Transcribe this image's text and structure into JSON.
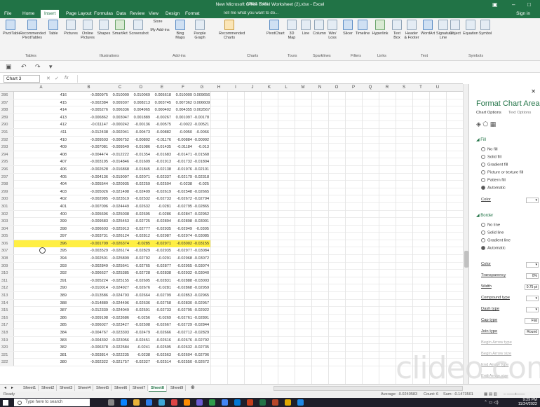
{
  "titlebar": {
    "tools": "Chart Tools",
    "document": "New Microsoft Office Excel Worksheet (2).xlsx - Excel"
  },
  "menubar": {
    "tabs": [
      "File",
      "Home",
      "Insert",
      "Page Layout",
      "Formulas",
      "Data",
      "Review",
      "View",
      "Design",
      "Format"
    ],
    "active": "Insert",
    "tellme": "Tell me what you want to do...",
    "signin": "Sign in"
  },
  "ribbon": {
    "buttons": [
      "PivotTable",
      "Recommended PivotTables",
      "Table",
      "Pictures",
      "Online Pictures",
      "Shapes",
      "SmartArt",
      "Screenshot",
      "Store",
      "My Add-ins",
      "Bing Maps",
      "People Graph",
      "Recommended Charts",
      "PivotChart",
      "3D Map",
      "Line",
      "Column",
      "Win/ Loss",
      "Slicer",
      "Timeline",
      "Hyperlink",
      "Text Box",
      "Header & Footer",
      "WordArt",
      "Signature Line",
      "Object",
      "Equation",
      "Symbol"
    ],
    "groups": [
      "Tables",
      "Illustrations",
      "Add-ins",
      "Charts",
      "Tours",
      "Sparklines",
      "Filters",
      "Links",
      "Text",
      "Symbols"
    ]
  },
  "formula_bar": {
    "name_box": "Chart 3",
    "fx": "fx",
    "value": ""
  },
  "columns": [
    "A",
    "B",
    "C",
    "D",
    "E",
    "F",
    "G",
    "H",
    "I",
    "J",
    "K",
    "L",
    "M",
    "N",
    "O",
    "P",
    "Q",
    "R",
    "S",
    "T",
    "U"
  ],
  "rows": [
    {
      "n": "286",
      "a": "416",
      "b": "-0.000975",
      "c": "0.010009",
      "d": "0.010069",
      "e": "0.005618",
      "f": "0.010009",
      "g": "0.009656"
    },
    {
      "n": "287",
      "a": "415",
      "b": "-0.002384",
      "c": "0.009307",
      "d": "0.008213",
      "e": "0.003745",
      "f": "0.007362",
      "g": "0.006609"
    },
    {
      "n": "288",
      "a": "414",
      "b": "-0.005276",
      "c": "0.006336",
      "d": "0.004965",
      "e": "0.000402",
      "f": "0.004355",
      "g": "0.002567"
    },
    {
      "n": "289",
      "a": "413",
      "b": "-0.006862",
      "c": "0.003047",
      "d": "0.001889",
      "e": "-0.00267",
      "f": "0.001097",
      "g": "-0.00178"
    },
    {
      "n": "290",
      "a": "412",
      "b": "-0.011147",
      "c": "-0.000242",
      "d": "-0.00136",
      "e": "-0.00575",
      "f": "-0.0022",
      "g": "-0.00521"
    },
    {
      "n": "291",
      "a": "411",
      "b": "-0.012438",
      "c": "-0.002041",
      "d": "-0.00473",
      "e": "-0.00882",
      "f": "-0.0050",
      "g": "-0.0066"
    },
    {
      "n": "292",
      "a": "410",
      "b": "-0.009503",
      "c": "-0.006752",
      "d": "-0.00802",
      "e": "-0.01176",
      "f": "-0.00884",
      "g": "-0.00992"
    },
    {
      "n": "293",
      "a": "409",
      "b": "-0.007081",
      "c": "-0.009549",
      "d": "-0.01086",
      "e": "-0.01435",
      "f": "-0.01184",
      "g": "-0.013"
    },
    {
      "n": "294",
      "a": "408",
      "b": "-0.004474",
      "c": "-0.012222",
      "d": "-0.01354",
      "e": "-0.01683",
      "f": "-0.01471",
      "g": "-0.01568"
    },
    {
      "n": "295",
      "a": "407",
      "b": "-0.003195",
      "c": "-0.014846",
      "d": "-0.01609",
      "e": "-0.01913",
      "f": "-0.01732",
      "g": "-0.01804"
    },
    {
      "n": "296",
      "a": "406",
      "b": "-0.002628",
      "c": "-0.016868",
      "d": "-0.01845",
      "e": "-0.02138",
      "f": "-0.01976",
      "g": "-0.02101"
    },
    {
      "n": "297",
      "a": "405",
      "b": "-0.004136",
      "c": "-0.019097",
      "d": "-0.02071",
      "e": "-0.02337",
      "f": "-0.02179",
      "g": "-0.02318"
    },
    {
      "n": "298",
      "a": "404",
      "b": "-0.005544",
      "c": "-0.020935",
      "d": "-0.02259",
      "e": "-0.02504",
      "f": "-0.0238",
      "g": "-0.025"
    },
    {
      "n": "299",
      "a": "403",
      "b": "-0.005026",
      "c": "-0.021498",
      "d": "-0.02409",
      "e": "-0.02619",
      "f": "-0.02548",
      "g": "-0.02665"
    },
    {
      "n": "300",
      "a": "402",
      "b": "-0.002985",
      "c": "-0.023519",
      "d": "-0.02532",
      "e": "-0.02733",
      "f": "-0.02672",
      "g": "-0.02794"
    },
    {
      "n": "301",
      "a": "401",
      "b": "-0.007096",
      "c": "-0.024449",
      "d": "-0.02632",
      "e": "-0.0281",
      "f": "-0.02795",
      "g": "-0.02865"
    },
    {
      "n": "302",
      "a": "400",
      "b": "-0.005696",
      "c": "-0.025038",
      "d": "-0.02695",
      "e": "-0.0286",
      "f": "-0.02847",
      "g": "-0.02952"
    },
    {
      "n": "303",
      "a": "399",
      "b": "-0.009583",
      "c": "-0.025453",
      "d": "-0.02725",
      "e": "-0.02894",
      "f": "-0.02898",
      "g": "-0.03001"
    },
    {
      "n": "304",
      "a": "398",
      "b": "-0.006603",
      "c": "-0.025913",
      "d": "-0.02777",
      "e": "-0.02935",
      "f": "-0.02949",
      "g": "-0.0305"
    },
    {
      "n": "305",
      "a": "397",
      "b": "-0.003731",
      "c": "-0.026124",
      "d": "-0.02812",
      "e": "-0.02987",
      "f": "-0.02974",
      "g": "-0.03085"
    },
    {
      "n": "306",
      "a": "396",
      "b": "-0.001709",
      "c": "-0.026374",
      "d": "-0.0285",
      "e": "-0.02971",
      "f": "-0.03002",
      "g": "-0.03155"
    },
    {
      "n": "307",
      "a": "395",
      "b": "-0.003529",
      "c": "-0.026174",
      "d": "-0.02829",
      "e": "-0.02935",
      "f": "-0.02977",
      "g": "-0.03084"
    },
    {
      "n": "308",
      "a": "394",
      "b": "-0.002501",
      "c": "-0.025809",
      "d": "-0.02792",
      "e": "-0.0291",
      "f": "-0.02968",
      "g": "-0.03072"
    },
    {
      "n": "309",
      "a": "393",
      "b": "-0.002849",
      "c": "-0.025641",
      "d": "-0.02765",
      "e": "-0.02877",
      "f": "-0.02955",
      "g": "-0.03074"
    },
    {
      "n": "310",
      "a": "392",
      "b": "-0.006627",
      "c": "-0.025385",
      "d": "-0.02728",
      "e": "-0.02838",
      "f": "-0.02932",
      "g": "-0.03040"
    },
    {
      "n": "311",
      "a": "391",
      "b": "-0.005224",
      "c": "-0.025155",
      "d": "-0.02695",
      "e": "-0.02831",
      "f": "-0.02888",
      "g": "-0.03003"
    },
    {
      "n": "312",
      "a": "390",
      "b": "-0.010014",
      "c": "-0.024927",
      "d": "-0.02676",
      "e": "-0.0281",
      "f": "-0.02868",
      "g": "-0.02959"
    },
    {
      "n": "313",
      "a": "389",
      "b": "-0.013586",
      "c": "-0.024793",
      "d": "-0.02664",
      "e": "-0.02799",
      "f": "-0.02853",
      "g": "-0.02965"
    },
    {
      "n": "314",
      "a": "388",
      "b": "-0.014889",
      "c": "-0.024496",
      "d": "-0.02636",
      "e": "-0.02758",
      "f": "-0.02830",
      "g": "-0.02957"
    },
    {
      "n": "315",
      "a": "387",
      "b": "-0.012339",
      "c": "-0.024049",
      "d": "-0.02591",
      "e": "-0.02733",
      "f": "-0.02795",
      "g": "-0.02922"
    },
    {
      "n": "316",
      "a": "386",
      "b": "-0.009198",
      "c": "-0.023686",
      "d": "-0.0256",
      "e": "-0.0269",
      "f": "-0.02761",
      "g": "-0.02891"
    },
    {
      "n": "317",
      "a": "385",
      "b": "-0.006027",
      "c": "-0.023427",
      "d": "-0.02508",
      "e": "-0.02667",
      "f": "-0.02729",
      "g": "-0.02844"
    },
    {
      "n": "318",
      "a": "384",
      "b": "-0.004767",
      "c": "-0.023303",
      "d": "-0.02479",
      "e": "-0.02666",
      "f": "-0.02712",
      "g": "-0.02829"
    },
    {
      "n": "319",
      "a": "383",
      "b": "-0.004392",
      "c": "-0.023056",
      "d": "-0.02451",
      "e": "-0.02616",
      "f": "-0.02676",
      "g": "-0.02792"
    },
    {
      "n": "320",
      "a": "382",
      "b": "-0.006378",
      "c": "-0.022584",
      "d": "-0.0241",
      "e": "-0.02595",
      "f": "-0.02632",
      "g": "-0.02735"
    },
    {
      "n": "321",
      "a": "381",
      "b": "-0.003814",
      "c": "-0.022235",
      "d": "-0.0238",
      "e": "-0.02563",
      "f": "-0.02604",
      "g": "-0.02706"
    },
    {
      "n": "322",
      "a": "380",
      "b": "-0.002322",
      "c": "-0.021757",
      "d": "-0.02327",
      "e": "-0.02514",
      "f": "-0.02550",
      "g": "-0.02672"
    }
  ],
  "highlight_row": "306",
  "pane": {
    "title": "Format Chart Area",
    "chart_options": "Chart Options",
    "text_options": "Text Options",
    "fill": {
      "title": "Fill",
      "options": [
        "No fill",
        "Solid fill",
        "Gradient fill",
        "Picture or texture fill",
        "Pattern fill",
        "Automatic"
      ],
      "selected": "Automatic",
      "color": "Color"
    },
    "border": {
      "title": "Border",
      "options": [
        "No line",
        "Solid line",
        "Gradient line",
        "Automatic"
      ],
      "selected": "Automatic",
      "props": [
        "Color",
        "Transparency",
        "Width",
        "Compound type",
        "Dash type",
        "Cap type",
        "Join type",
        "Begin Arrow type",
        "Begin Arrow size",
        "End Arrow type",
        "End Arrow size"
      ],
      "transparency": "0%",
      "width": "0.75 pt",
      "cap": "Flat",
      "join": "Round"
    }
  },
  "sheets": [
    "Sheet1",
    "Sheet2",
    "Sheet3",
    "Sheet4",
    "Sheet5",
    "Sheet6",
    "Sheet7",
    "Sheet8",
    "Sheet9"
  ],
  "active_sheet": "Sheet8",
  "status": {
    "ready": "Ready",
    "average": "Average: -0.0240583",
    "count": "Count: 6",
    "sum": "Sum: -0.1473501"
  },
  "taskbar": {
    "search": "Type here to search",
    "time": "9:29 PM",
    "date": "11/24/2022"
  },
  "watermark": "clideo.com",
  "colors": {
    "excel_green": "#217346",
    "highlight": "#ffef44",
    "taskbar": "#1f1f2a"
  }
}
